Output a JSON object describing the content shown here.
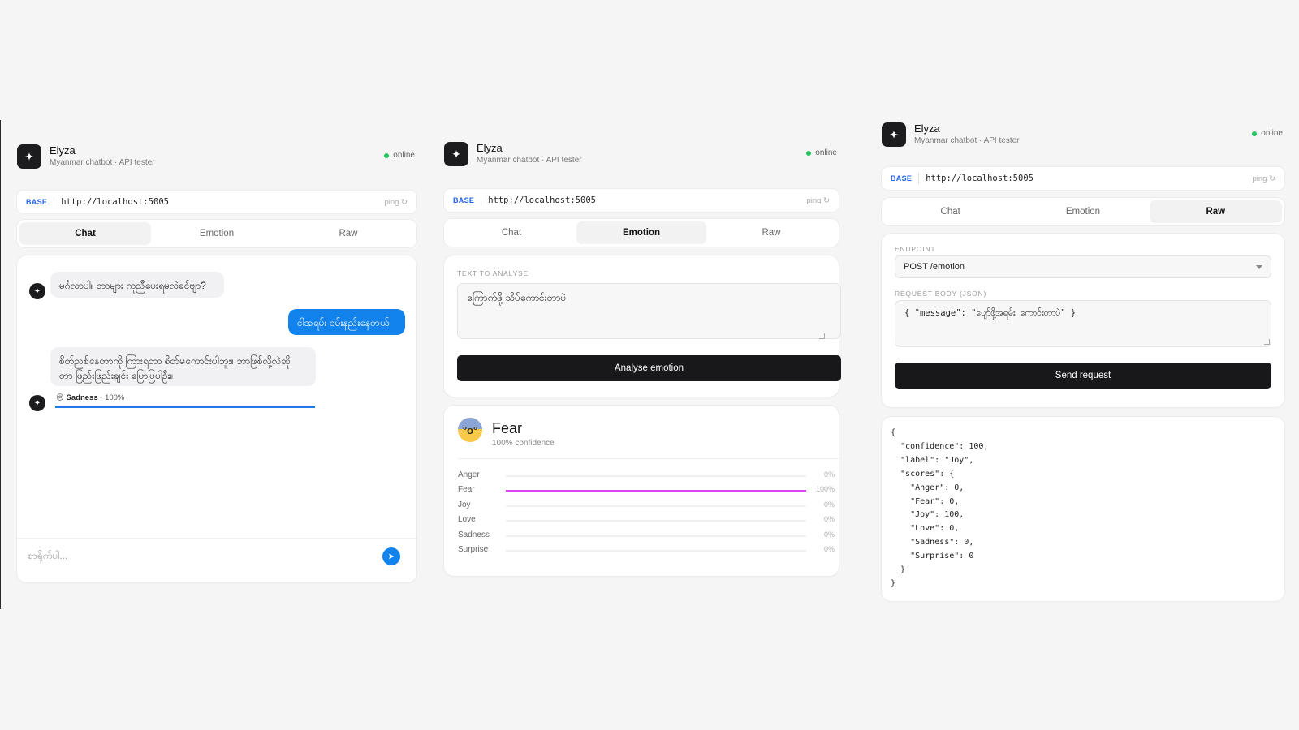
{
  "app": {
    "title": "Elyza",
    "subtitle": "Myanmar chatbot · API tester",
    "status": "online",
    "logo_icon": "✦"
  },
  "base": {
    "tag": "BASE",
    "url": "http://localhost:5005",
    "ping": "ping ↻"
  },
  "tabs": [
    "Chat",
    "Emotion",
    "Raw"
  ],
  "chat": {
    "messages": [
      {
        "role": "bot",
        "text": "မင်္ဂလာပါ။ ဘာများ ကူညီပေးရမလဲခင်ဗျာ?"
      },
      {
        "role": "user",
        "text": "ငါအရမ်း ဝမ်းနည်းနေတယ်"
      },
      {
        "role": "bot",
        "text_line1": "စိတ်ညစ်နေတာကို ကြားရတာ စိတ်မကောင်းပါဘူး။ ဘာဖြစ်လို့လဲဆို",
        "text_line2": "တာ ဖြည်းဖြည်းချင်း ပြောပြပါဦး။"
      }
    ],
    "emotion_tag": {
      "emoji": "😔",
      "label": "Sadness",
      "value": "· 100%",
      "percent": 100
    },
    "input_placeholder": "စာရိုက်ပါ...",
    "send_icon": "➤"
  },
  "emotion": {
    "field_label": "TEXT TO ANALYSE",
    "input_text": "ကြောက်ဖို့ သိပ်ကောင်းတာပဲ",
    "button_label": "Analyse emotion",
    "result": {
      "label": "Fear",
      "confidence": "100% confidence",
      "scores": [
        {
          "name": "Anger",
          "pct": "0%",
          "value": 0
        },
        {
          "name": "Fear",
          "pct": "100%",
          "value": 100
        },
        {
          "name": "Joy",
          "pct": "0%",
          "value": 0
        },
        {
          "name": "Love",
          "pct": "0%",
          "value": 0
        },
        {
          "name": "Sadness",
          "pct": "0%",
          "value": 0
        },
        {
          "name": "Surprise",
          "pct": "0%",
          "value": 0
        }
      ]
    }
  },
  "raw": {
    "endpoint_label": "ENDPOINT",
    "endpoint_value": "POST /emotion",
    "body_label": "REQUEST BODY (JSON)",
    "body_value": "{ \"message\": \"ပျော်ဖို့အရမ်း ကောင်းတာပဲ\" }",
    "button_label": "Send request",
    "response_lines": [
      "{",
      "  \"confidence\": 100,",
      "  \"label\": \"Joy\",",
      "  \"scores\": {",
      "    \"Anger\": 0,",
      "    \"Fear\": 0,",
      "    \"Joy\": 100,",
      "    \"Love\": 0,",
      "    \"Sadness\": 0,",
      "    \"Surprise\": 0",
      "  }",
      "}"
    ]
  },
  "colors": {
    "accent": "#1283ec",
    "online": "#22c55e",
    "fear_bar": "#d946ef",
    "sadness_bar": "#1e7be6",
    "dark_button": "#18181b"
  }
}
